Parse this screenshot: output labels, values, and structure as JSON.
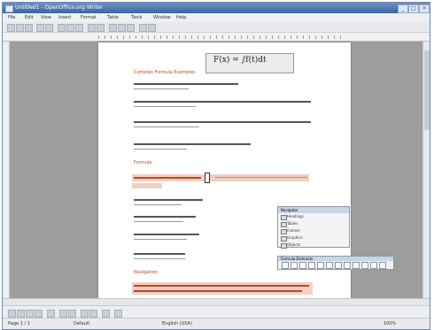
{
  "window": {
    "title": "Untitled1 - OpenOffice.org Writer"
  },
  "menu": [
    "File",
    "Edit",
    "View",
    "Insert",
    "Format",
    "Table",
    "Tools",
    "Window",
    "Help"
  ],
  "document": {
    "heading": "Complex Formula Examples",
    "equation": "F(x) = ∫f(t)dt",
    "section_1": "Formula",
    "section_2": "Navigation"
  },
  "navigator": {
    "title": "Navigator",
    "items": [
      "Headings",
      "Tables",
      "Frames",
      "Graphics",
      "Objects"
    ]
  },
  "format_bar": {
    "title": "Formula Elements"
  },
  "statusbar": {
    "page": "Page 1 / 1",
    "style": "Default",
    "language": "English (USA)",
    "zoom": "100%"
  }
}
